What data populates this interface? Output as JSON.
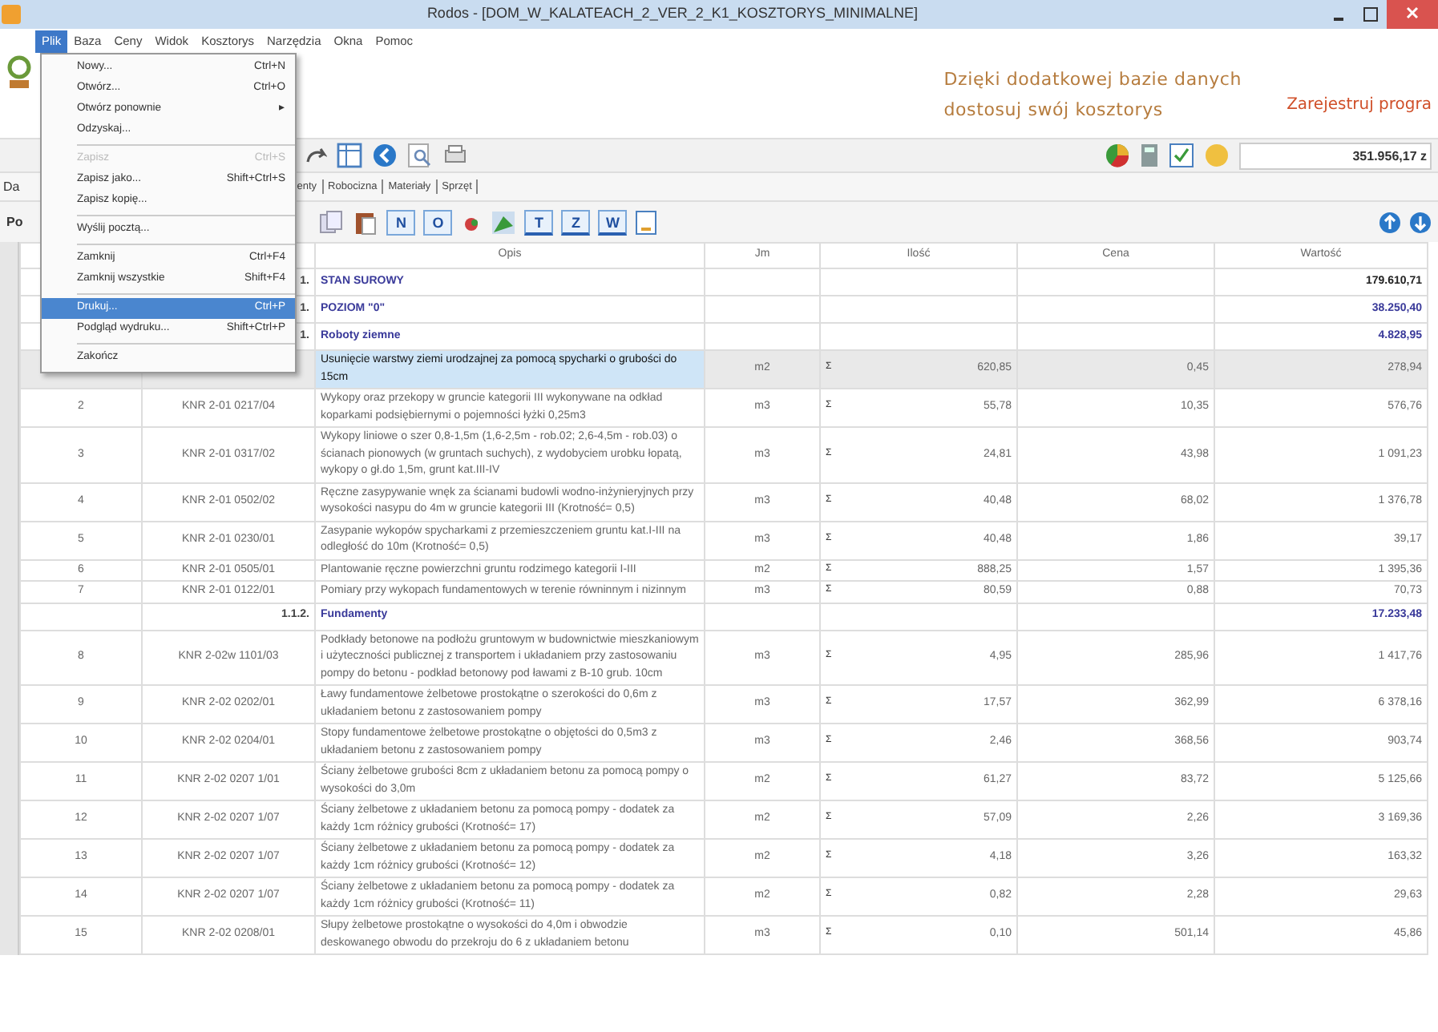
{
  "window": {
    "title": "Rodos - [DOM_W_KALATEACH_2_VER_2_K1_KOSZTORYS_MINIMALNE]"
  },
  "menu_bar": [
    {
      "label": "Plik",
      "selected": true
    },
    {
      "label": "Baza",
      "selected": false
    },
    {
      "label": "Ceny",
      "selected": false
    },
    {
      "label": "Widok",
      "selected": false
    },
    {
      "label": "Kosztorys",
      "selected": false
    },
    {
      "label": "Narzędzia",
      "selected": false
    },
    {
      "label": "Okna",
      "selected": false
    },
    {
      "label": "Pomoc",
      "selected": false
    }
  ],
  "file_menu": [
    {
      "kind": "item",
      "label": "Nowy...",
      "shortcut": "Ctrl+N",
      "disabled": false,
      "selected": false
    },
    {
      "kind": "item",
      "label": "Otwórz...",
      "shortcut": "Ctrl+O",
      "disabled": false,
      "selected": false
    },
    {
      "kind": "submenu",
      "label": "Otwórz ponownie",
      "arrow": "▸",
      "disabled": false,
      "selected": false
    },
    {
      "kind": "item",
      "label": "Odzyskaj...",
      "disabled": false,
      "selected": false
    },
    {
      "kind": "separator"
    },
    {
      "kind": "item",
      "label": "Zapisz",
      "shortcut": "Ctrl+S",
      "disabled": true,
      "selected": false
    },
    {
      "kind": "item",
      "label": "Zapisz jako...",
      "shortcut": "Shift+Ctrl+S",
      "disabled": false,
      "selected": false
    },
    {
      "kind": "item",
      "label": "Zapisz kopię...",
      "disabled": false,
      "selected": false
    },
    {
      "kind": "separator"
    },
    {
      "kind": "item",
      "label": "Wyślij pocztą...",
      "disabled": false,
      "selected": false
    },
    {
      "kind": "separator"
    },
    {
      "kind": "item",
      "label": "Zamknij",
      "shortcut": "Ctrl+F4",
      "disabled": false,
      "selected": false
    },
    {
      "kind": "item",
      "label": "Zamknij wszystkie",
      "shortcut": "Shift+F4",
      "disabled": false,
      "selected": false
    },
    {
      "kind": "separator"
    },
    {
      "kind": "item",
      "label": "Drukuj...",
      "shortcut": "Ctrl+P",
      "disabled": false,
      "selected": true
    },
    {
      "kind": "item",
      "label": "Podgląd wydruku...",
      "shortcut": "Shift+Ctrl+P",
      "disabled": false,
      "selected": false
    },
    {
      "kind": "separator"
    },
    {
      "kind": "item",
      "label": "Zakończ",
      "disabled": false,
      "selected": false
    }
  ],
  "banner": {
    "lines": [
      "Dzięki dodatkowej bazie danych",
      "dostosuj swój kosztorys"
    ],
    "register": "Zarejestruj progra"
  },
  "total": "351.956,17 z",
  "tabs": {
    "left_label": "Da",
    "items": [
      {
        "label": "enty",
        "selected": false
      },
      {
        "label": "Robocizna",
        "selected": false
      },
      {
        "label": "Materiały",
        "selected": false
      },
      {
        "label": "Sprzęt",
        "selected": false
      }
    ]
  },
  "toolbar2": {
    "left_label": "Po",
    "letter_buttons": [
      "N",
      "O",
      "T",
      "Z",
      "W"
    ]
  },
  "table": {
    "columns": [
      "Opis",
      "Jm",
      "Ilość",
      "Cena",
      "Wartość"
    ],
    "rows": [
      {
        "kind": "section",
        "number": "1.",
        "opis": "STAN SUROWY",
        "wartosc": "179.610,71"
      },
      {
        "kind": "section",
        "number": "1.",
        "opis": "POZIOM \"0\"",
        "wartosc": "38.250,40"
      },
      {
        "kind": "section",
        "number": "1.",
        "opis": "Roboty ziemne",
        "wartosc": "4.828,95"
      },
      {
        "kind": "item",
        "selected": true,
        "opis": "Usunięcie warstwy ziemi urodzajnej za pomocą spycharki o grubości do 15cm",
        "jm": "m2",
        "mark": "Σ",
        "ilosc": "620,85",
        "cena": "0,45",
        "wartosc": "278,94"
      },
      {
        "kind": "item",
        "selected": false,
        "lp": "2",
        "code": "KNR 2-01 0217/04",
        "opis": "Wykopy oraz przekopy w gruncie kategorii III wykonywane na odkład koparkami podsiębiernymi o pojemności łyżki 0,25m3",
        "jm": "m3",
        "mark": "Σ",
        "ilosc": "55,78",
        "cena": "10,35",
        "wartosc": "576,76"
      },
      {
        "kind": "item",
        "selected": false,
        "lp": "3",
        "code": "KNR 2-01 0317/02",
        "opis": "Wykopy liniowe o szer 0,8-1,5m (1,6-2,5m - rob.02; 2,6-4,5m - rob.03) o ścianach pionowych (w gruntach suchych), z wydobyciem urobku łopatą, wykopy o gł.do 1,5m, grunt kat.III-IV",
        "jm": "m3",
        "mark": "Σ",
        "ilosc": "24,81",
        "cena": "43,98",
        "wartosc": "1 091,23"
      },
      {
        "kind": "item",
        "selected": false,
        "lp": "4",
        "code": "KNR 2-01 0502/02",
        "opis": "Ręczne zasypywanie wnęk za ścianami budowli wodno-inżynieryjnych przy wysokości nasypu do 4m w gruncie kategorii III (Krotność= 0,5)",
        "jm": "m3",
        "mark": "Σ",
        "ilosc": "40,48",
        "cena": "68,02",
        "wartosc": "1 376,78"
      },
      {
        "kind": "item",
        "selected": false,
        "lp": "5",
        "code": "KNR 2-01 0230/01",
        "opis": "Zasypanie wykopów spycharkami z przemieszczeniem gruntu kat.I-III na odległość do 10m (Krotność= 0,5)",
        "jm": "m3",
        "mark": "Σ",
        "ilosc": "40,48",
        "cena": "1,86",
        "wartosc": "39,17"
      },
      {
        "kind": "item",
        "selected": false,
        "lp": "6",
        "code": "KNR 2-01 0505/01",
        "opis": "Plantowanie ręczne powierzchni gruntu rodzimego kategorii I-III",
        "jm": "m2",
        "mark": "Σ",
        "ilosc": "888,25",
        "cena": "1,57",
        "wartosc": "1 395,36"
      },
      {
        "kind": "item",
        "selected": false,
        "lp": "7",
        "code": "KNR 2-01 0122/01",
        "opis": "Pomiary przy wykopach fundamentowych w terenie równinnym i nizinnym",
        "jm": "m3",
        "mark": "Σ",
        "ilosc": "80,59",
        "cena": "0,88",
        "wartosc": "70,73"
      },
      {
        "kind": "section",
        "number": "1.1.2.",
        "opis": "Fundamenty",
        "wartosc": "17.233,48"
      },
      {
        "kind": "item",
        "selected": false,
        "lp": "8",
        "code": "KNR 2-02w 1101/03",
        "opis": "Podkłady betonowe na podłożu gruntowym w budownictwie mieszkaniowym i użyteczności publicznej z transportem i układaniem przy zastosowaniu pompy do betonu - podkład betonowy pod ławami z B-10 grub. 10cm",
        "jm": "m3",
        "mark": "Σ",
        "ilosc": "4,95",
        "cena": "285,96",
        "wartosc": "1 417,76"
      },
      {
        "kind": "item",
        "selected": false,
        "lp": "9",
        "code": "KNR 2-02 0202/01",
        "opis": "Ławy fundamentowe żelbetowe prostokątne o szerokości do 0,6m z układaniem betonu z zastosowaniem pompy",
        "jm": "m3",
        "mark": "Σ",
        "ilosc": "17,57",
        "cena": "362,99",
        "wartosc": "6 378,16"
      },
      {
        "kind": "item",
        "selected": false,
        "lp": "10",
        "code": "KNR 2-02 0204/01",
        "opis": "Stopy fundamentowe żelbetowe prostokątne o objętości do 0,5m3 z układaniem betonu z zastosowaniem pompy",
        "jm": "m3",
        "mark": "Σ",
        "ilosc": "2,46",
        "cena": "368,56",
        "wartosc": "903,74"
      },
      {
        "kind": "item",
        "selected": false,
        "lp": "11",
        "code": "KNR 2-02 0207 1/01",
        "opis": "Ściany żelbetowe grubości 8cm z układaniem betonu za pomocą pompy o wysokości do 3,0m",
        "jm": "m2",
        "mark": "Σ",
        "ilosc": "61,27",
        "cena": "83,72",
        "wartosc": "5 125,66"
      },
      {
        "kind": "item",
        "selected": false,
        "lp": "12",
        "code": "KNR 2-02 0207 1/07",
        "opis": "Ściany żelbetowe z układaniem betonu za pomocą pompy - dodatek za każdy 1cm różnicy grubości (Krotność= 17)",
        "jm": "m2",
        "mark": "Σ",
        "ilosc": "57,09",
        "cena": "2,26",
        "wartosc": "3 169,36"
      },
      {
        "kind": "item",
        "selected": false,
        "lp": "13",
        "code": "KNR 2-02 0207 1/07",
        "opis": "Ściany żelbetowe z układaniem betonu za pomocą pompy - dodatek za każdy 1cm różnicy grubości (Krotność= 12)",
        "jm": "m2",
        "mark": "Σ",
        "ilosc": "4,18",
        "cena": "3,26",
        "wartosc": "163,32"
      },
      {
        "kind": "item",
        "selected": false,
        "lp": "14",
        "code": "KNR 2-02 0207 1/07",
        "opis": "Ściany żelbetowe z układaniem betonu za pomocą pompy - dodatek za każdy 1cm różnicy grubości (Krotność= 11)",
        "jm": "m2",
        "mark": "Σ",
        "ilosc": "0,82",
        "cena": "2,28",
        "wartosc": "29,63"
      },
      {
        "kind": "item",
        "selected": false,
        "lp": "15",
        "code": "KNR 2-02 0208/01",
        "opis": "Słupy żelbetowe prostokątne o wysokości do 4,0m i obwodzie deskowanego obwodu do przekroju do 6 z układaniem betonu",
        "jm": "m3",
        "mark": "Σ",
        "ilosc": "0,10",
        "cena": "501,14",
        "wartosc": "45,86"
      }
    ]
  }
}
